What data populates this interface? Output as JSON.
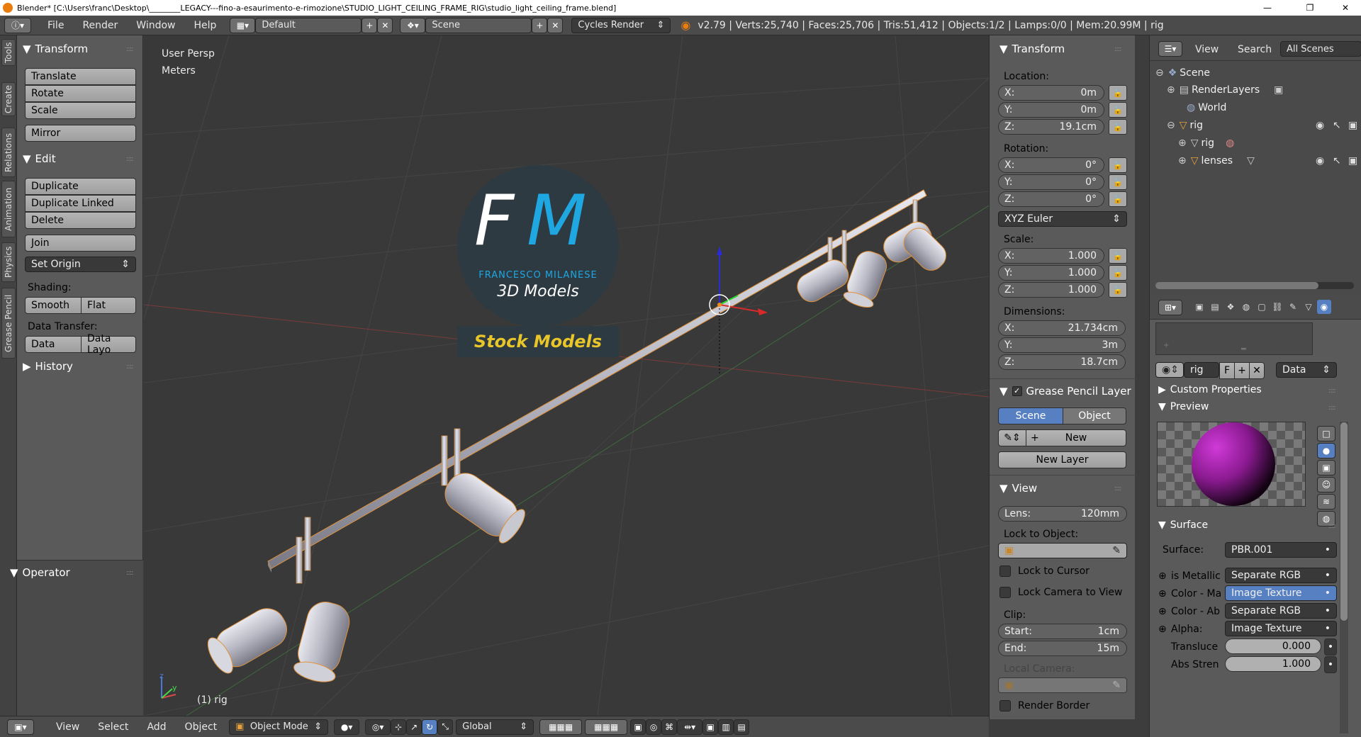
{
  "window": {
    "title": "Blender* [C:\\Users\\franc\\Desktop\\________LEGACY---fino-a-esaurimento-e-rimozione\\STUDIO_LIGHT_CEILING_FRAME_RIG\\studio_light_ceiling_frame.blend]",
    "minimize": "—",
    "maximize": "❐",
    "close": "✕"
  },
  "menubar": {
    "menus": [
      "File",
      "Render",
      "Window",
      "Help"
    ],
    "layout": "Default",
    "scene": "Scene",
    "engine": "Cycles Render",
    "stats": "v2.79 | Verts:25,740 | Faces:25,706 | Tris:51,412 | Objects:1/2 | Lamps:0/0 | Mem:20.99M | rig"
  },
  "left_tabs": [
    "Tools",
    "Create",
    "Relations",
    "Animation",
    "Physics",
    "Grease Pencil"
  ],
  "toolshelf": {
    "transform": {
      "title": "Transform",
      "buttons": [
        "Translate",
        "Rotate",
        "Scale",
        "Mirror"
      ]
    },
    "edit": {
      "title": "Edit",
      "buttons": [
        "Duplicate",
        "Duplicate Linked",
        "Delete",
        "Join"
      ],
      "set_origin": "Set Origin"
    },
    "shading": {
      "label": "Shading:",
      "smooth": "Smooth",
      "flat": "Flat"
    },
    "data_transfer": {
      "label": "Data Transfer:",
      "data": "Data",
      "data_layout": "Data Layo"
    },
    "history": "History",
    "operator": "Operator"
  },
  "viewport": {
    "view_name": "User Persp",
    "units": "Meters",
    "object_label": "(1) rig",
    "watermark": {
      "initials_f": "F",
      "initials_m": "M",
      "name": "FRANCESCO MILANESE",
      "sub": "3D Models",
      "banner": "Stock Models"
    },
    "axis_z": "z",
    "axis_y": "y"
  },
  "npanel": {
    "transform_title": "Transform",
    "location_label": "Location:",
    "location": {
      "x_label": "X:",
      "x": "0m",
      "y_label": "Y:",
      "y": "0m",
      "z_label": "Z:",
      "z": "19.1cm"
    },
    "rotation_label": "Rotation:",
    "rotation": {
      "x_label": "X:",
      "x": "0°",
      "y_label": "Y:",
      "y": "0°",
      "z_label": "Z:",
      "z": "0°"
    },
    "rotation_mode": "XYZ Euler",
    "scale_label": "Scale:",
    "scale": {
      "x_label": "X:",
      "x": "1.000",
      "y_label": "Y:",
      "y": "1.000",
      "z_label": "Z:",
      "z": "1.000"
    },
    "dimensions_label": "Dimensions:",
    "dimensions": {
      "x_label": "X:",
      "x": "21.734cm",
      "y_label": "Y:",
      "y": "3m",
      "z_label": "Z:",
      "z": "18.7cm"
    },
    "grease_title": "Grease Pencil Layer",
    "grease_scene": "Scene",
    "grease_object": "Object",
    "grease_new": "New",
    "grease_new_layer": "New Layer",
    "view_title": "View",
    "lens_label": "Lens:",
    "lens": "120mm",
    "lock_to_object": "Lock to Object:",
    "lock_cursor": "Lock to Cursor",
    "lock_camera": "Lock Camera to View",
    "clip_label": "Clip:",
    "clip_start_label": "Start:",
    "clip_start": "1cm",
    "clip_end_label": "End:",
    "clip_end": "15m",
    "local_camera": "Local Camera:",
    "render_border": "Render Border"
  },
  "outliner": {
    "view": "View",
    "search": "Search",
    "scope": "All Scenes",
    "rows": [
      "Scene",
      "RenderLayers",
      "World",
      "rig",
      "rig",
      "lenses"
    ]
  },
  "properties": {
    "datablock": "rig",
    "fake_user": "F",
    "data": "Data",
    "custom_props": "Custom Properties",
    "preview": "Preview",
    "surface_title": "Surface",
    "surface_label": "Surface:",
    "surface_value": "PBR.001",
    "inputs": [
      {
        "label": "is Metallic",
        "value": "Separate RGB"
      },
      {
        "label": "Color - Ma",
        "value": "Image Texture"
      },
      {
        "label": "Color - Ab",
        "value": "Separate RGB"
      },
      {
        "label": "Alpha:",
        "value": "Image Texture"
      }
    ],
    "translucence_label": "Transluce",
    "translucence": "0.000",
    "abs_strength_label": "Abs Stren",
    "abs_strength": "1.000"
  },
  "bottombar": {
    "menus": [
      "View",
      "Select",
      "Add",
      "Object"
    ],
    "mode": "Object Mode",
    "orientation": "Global"
  },
  "colors": {
    "accent_blue": "#5680c2",
    "watermark_blue": "#1ea7e1",
    "banner_yellow": "#e8c62a",
    "selection_orange": "#f08a24"
  }
}
